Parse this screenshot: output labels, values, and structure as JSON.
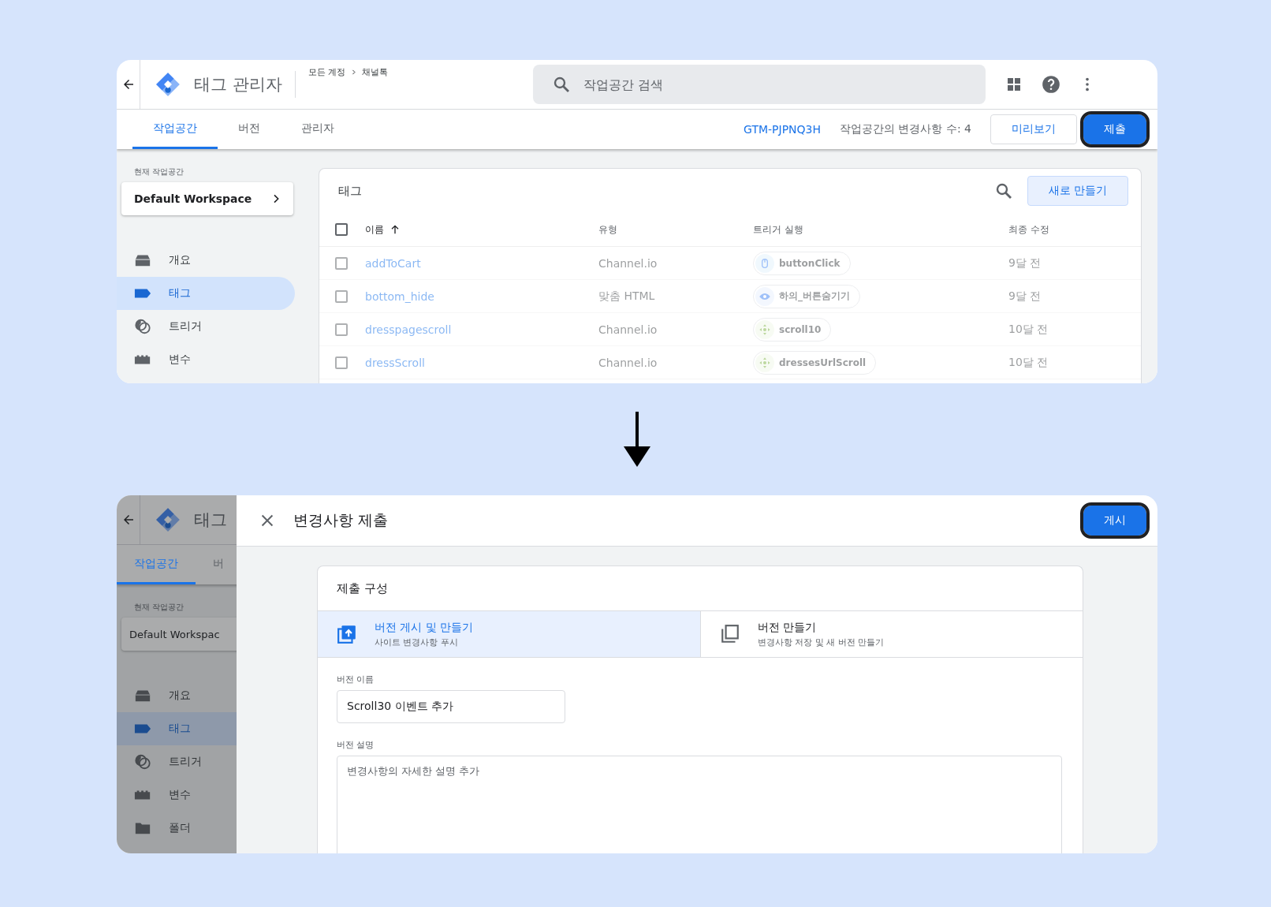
{
  "before": {
    "header": {
      "title": "태그 관리자",
      "breadcrumb": [
        "모든 계정",
        "채널톡"
      ],
      "search": {
        "placeholder": "작업공간 검색"
      }
    },
    "tabs": [
      {
        "label": "작업공간",
        "selected": true
      },
      {
        "label": "버전",
        "selected": false
      },
      {
        "label": "관리자",
        "selected": false
      }
    ],
    "container_id": "GTM-PJPNQ3H",
    "changes": "작업공간의 변경사항 수: 4",
    "preview_button": {
      "label": "미리보기"
    },
    "submit_button": {
      "label": "제출",
      "highlighted": true
    },
    "sidebar": {
      "workspace_label": "현재 작업공간",
      "workspace": "Default Workspace",
      "items": [
        {
          "label": "개요",
          "kind": "overview",
          "selected": false
        },
        {
          "label": "태그",
          "kind": "tag",
          "selected": true
        },
        {
          "label": "트리거",
          "kind": "trigger",
          "selected": false
        },
        {
          "label": "변수",
          "kind": "variable",
          "selected": false
        }
      ]
    },
    "table": {
      "title": "태그",
      "new_button": "새로 만들기",
      "select_all_checked": false,
      "columns": [
        "이름",
        "유형",
        "트리거 실행",
        "최종 수정"
      ],
      "rows": [
        {
          "checked": false,
          "name": "addToCart",
          "type": "Channel.io",
          "trigger": {
            "kind": "click",
            "label": "buttonClick"
          },
          "modified": "9달 전"
        },
        {
          "checked": false,
          "name": "bottom_hide",
          "type": "맞춤 HTML",
          "trigger": {
            "kind": "visibility",
            "label": "하의_버튼숨기기"
          },
          "modified": "9달 전"
        },
        {
          "checked": false,
          "name": "dresspagescroll",
          "type": "Channel.io",
          "trigger": {
            "kind": "scroll",
            "label": "scroll10"
          },
          "modified": "10달 전"
        },
        {
          "checked": false,
          "name": "dressScroll",
          "type": "Channel.io",
          "trigger": {
            "kind": "scroll",
            "label": "dressesUrlScroll"
          },
          "modified": "10달 전"
        }
      ]
    }
  },
  "after": {
    "background": {
      "title": "태그",
      "tabs": [
        {
          "label": "작업공간",
          "selected": true
        },
        {
          "label": "버",
          "selected": false
        }
      ],
      "workspace_label": "현재 작업공간",
      "workspace": "Default Workspac",
      "items": [
        {
          "label": "개요",
          "kind": "overview",
          "selected": false
        },
        {
          "label": "태그",
          "kind": "tag",
          "selected": true
        },
        {
          "label": "트리거",
          "kind": "trigger",
          "selected": false
        },
        {
          "label": "변수",
          "kind": "variable",
          "selected": false
        },
        {
          "label": "폴더",
          "kind": "folder",
          "selected": false
        }
      ]
    },
    "dialog": {
      "title": "변경사항 제출",
      "publish_button": {
        "label": "게시",
        "highlighted": true
      },
      "section_title": "제출 구성",
      "options": [
        {
          "kind": "publish",
          "title": "버전 게시 및 만들기",
          "subtitle": "사이트 변경사항 푸시",
          "selected": true
        },
        {
          "kind": "version",
          "title": "버전 만들기",
          "subtitle": "변경사항 저장 및 새 버전 만들기",
          "selected": false
        }
      ],
      "version_name": {
        "label": "버전 이름",
        "value": "Scroll30 이벤트 추가"
      },
      "version_description": {
        "label": "버전 설명",
        "placeholder": "변경사항의 자세한 설명 추가"
      }
    }
  }
}
